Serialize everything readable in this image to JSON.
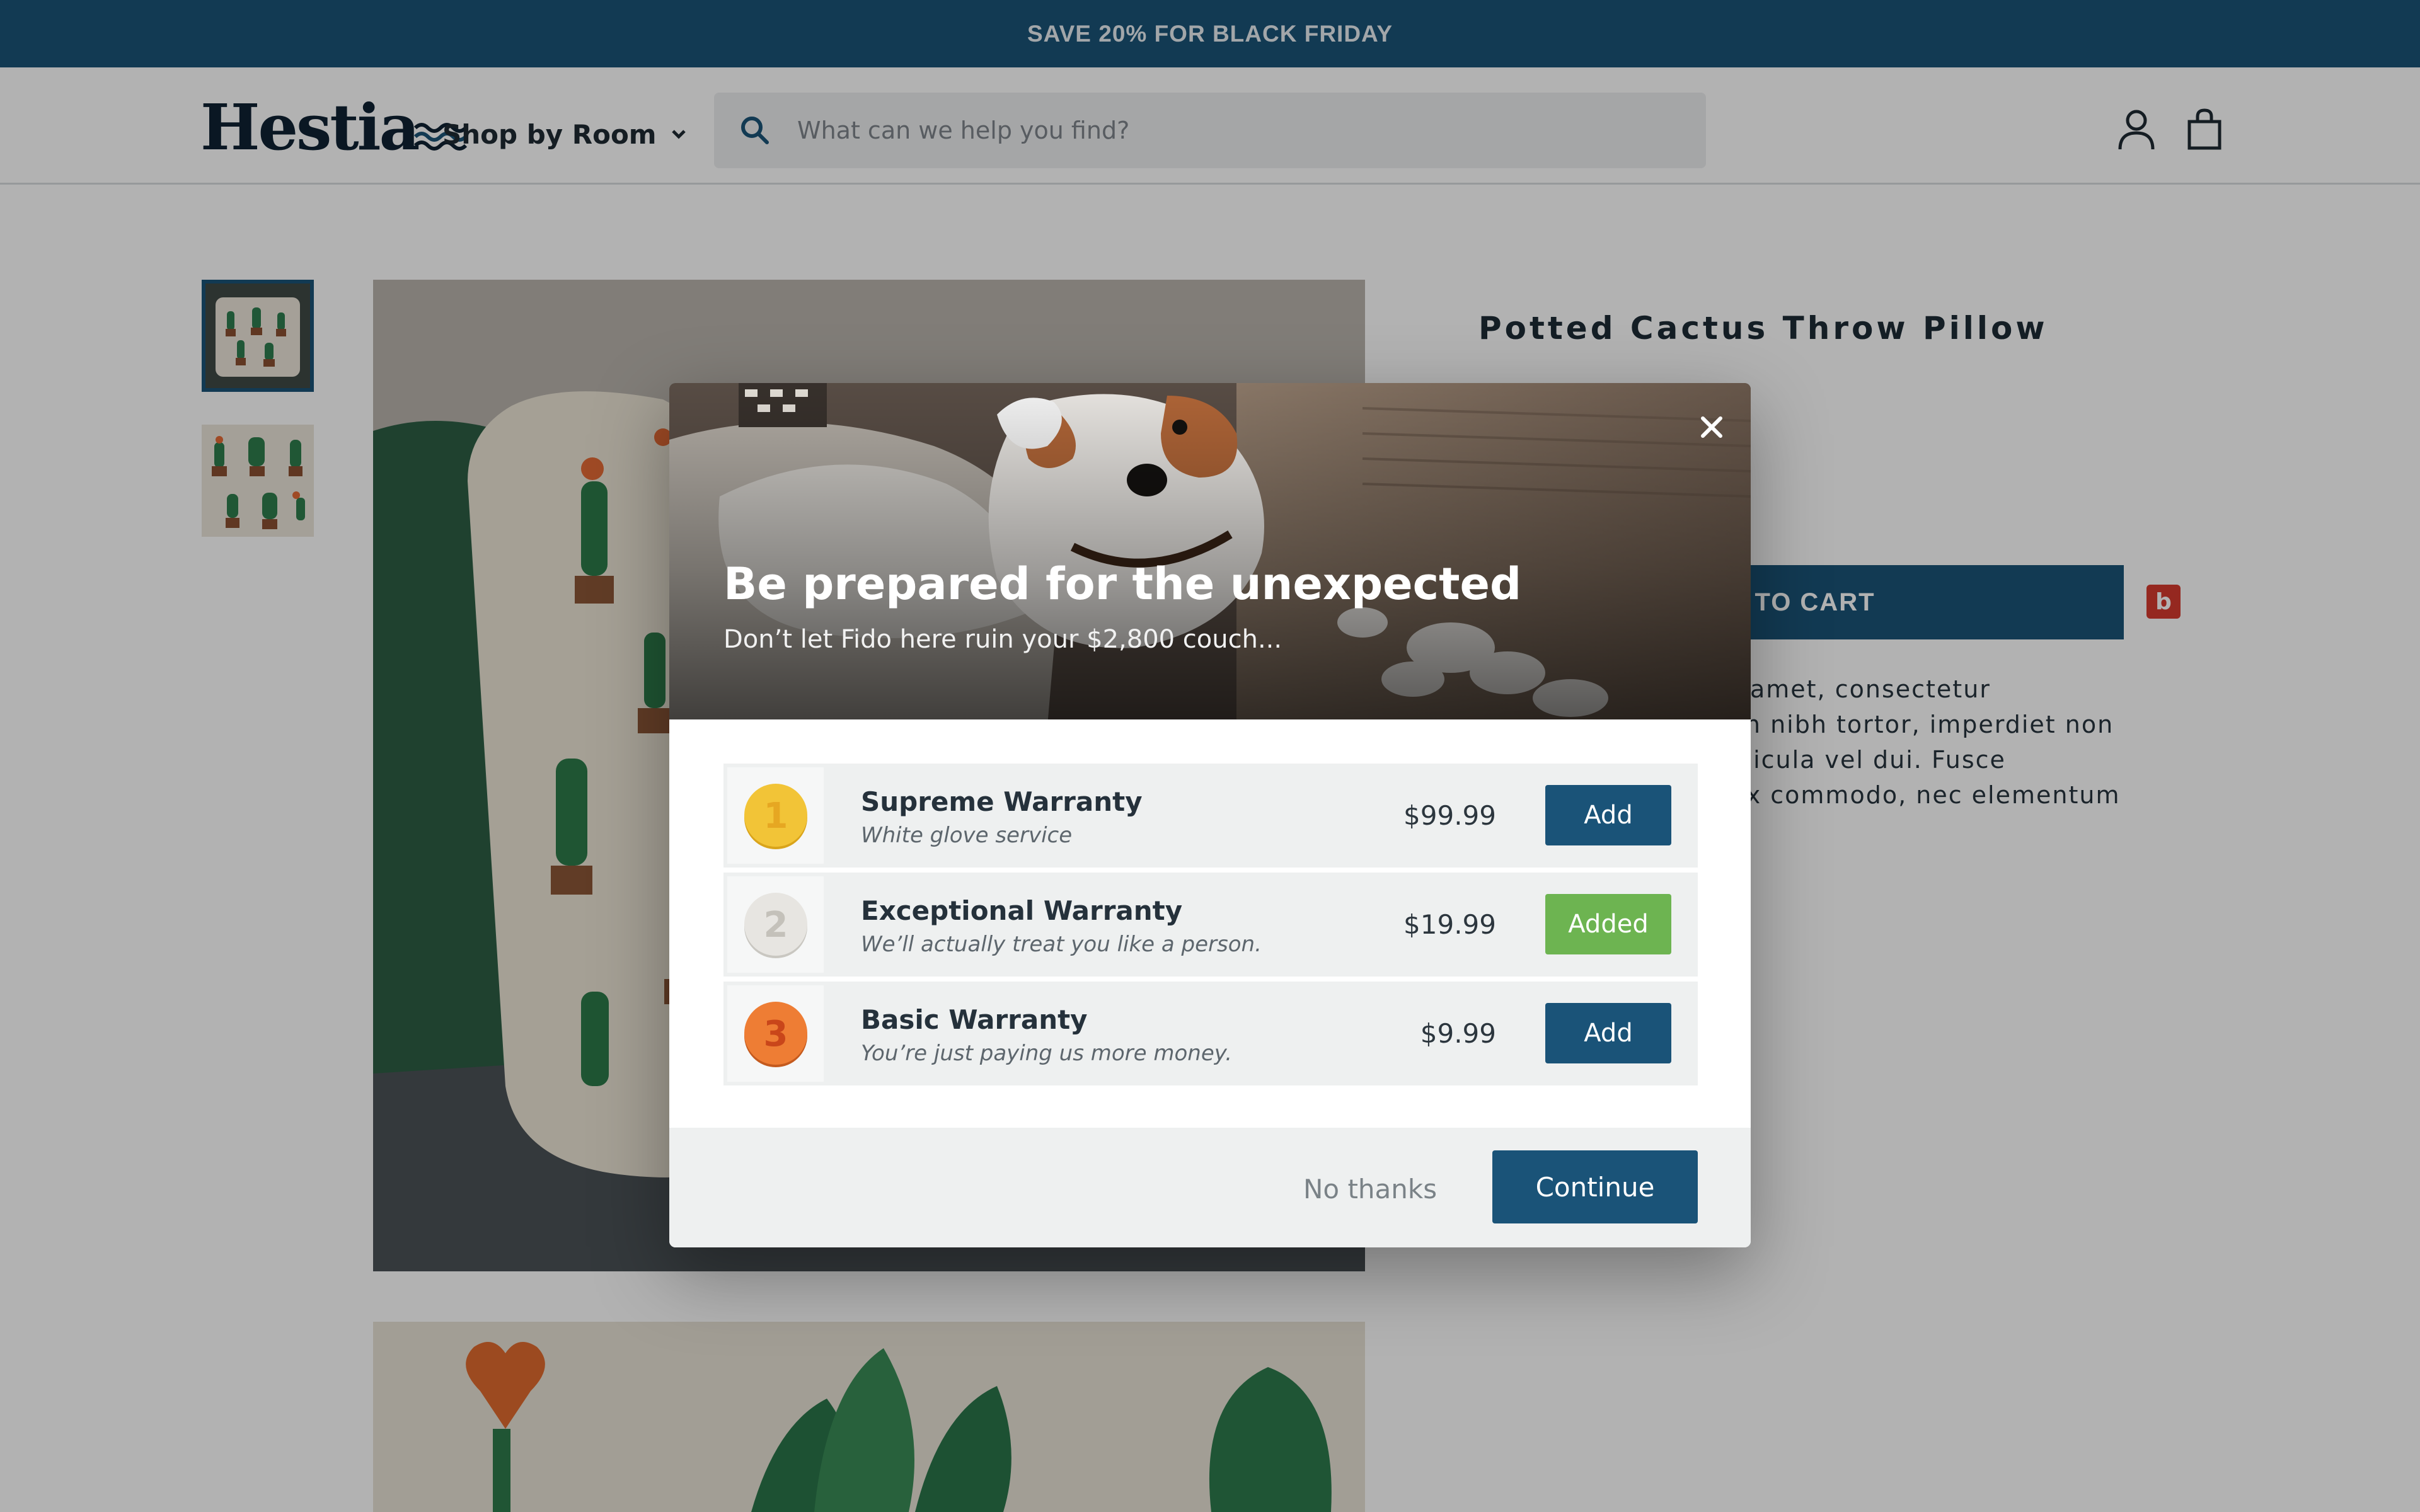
{
  "colors": {
    "brand": "#1a5378",
    "added_green": "#6db451",
    "overlay": "rgba(0,0,0,0.30)"
  },
  "promo_bar": {
    "text": "SAVE 20% FOR BLACK FRIDAY"
  },
  "header": {
    "logo_text": "Hestia",
    "nav": {
      "label": "Shop by Room",
      "icon": "chevron-down-icon"
    },
    "search": {
      "placeholder": "What can we help you find?",
      "icon": "search-icon"
    },
    "icons": [
      "account-icon",
      "shopping-bag-icon"
    ]
  },
  "product": {
    "title": "Potted Cactus Throw Pillow",
    "add_to_cart_visible": "D TO CART",
    "description_visible_lines": [
      "t amet, consectetur",
      "m nibh tortor, imperdiet non",
      "hicula vel dui. Fusce",
      "ex commodo, nec elementum"
    ],
    "badge_letter": "b"
  },
  "modal": {
    "title": "Be prepared for the unexpected",
    "subtitle": "Don’t let Fido here ruin your $2,800 couch...",
    "close_icon": "close-icon",
    "plans": [
      {
        "rank": "1",
        "medal": "gold",
        "name": "Supreme Warranty",
        "description": "White glove service",
        "price": "$99.99",
        "button": "Add",
        "state": "not-added"
      },
      {
        "rank": "2",
        "medal": "silver",
        "name": "Exceptional Warranty",
        "description": "We’ll actually treat you like a person.",
        "price": "$19.99",
        "button": "Added",
        "state": "added"
      },
      {
        "rank": "3",
        "medal": "bronze",
        "name": "Basic Warranty",
        "description": "You’re just paying us more money.",
        "price": "$9.99",
        "button": "Add",
        "state": "not-added"
      }
    ],
    "decline_label": "No thanks",
    "continue_label": "Continue"
  }
}
